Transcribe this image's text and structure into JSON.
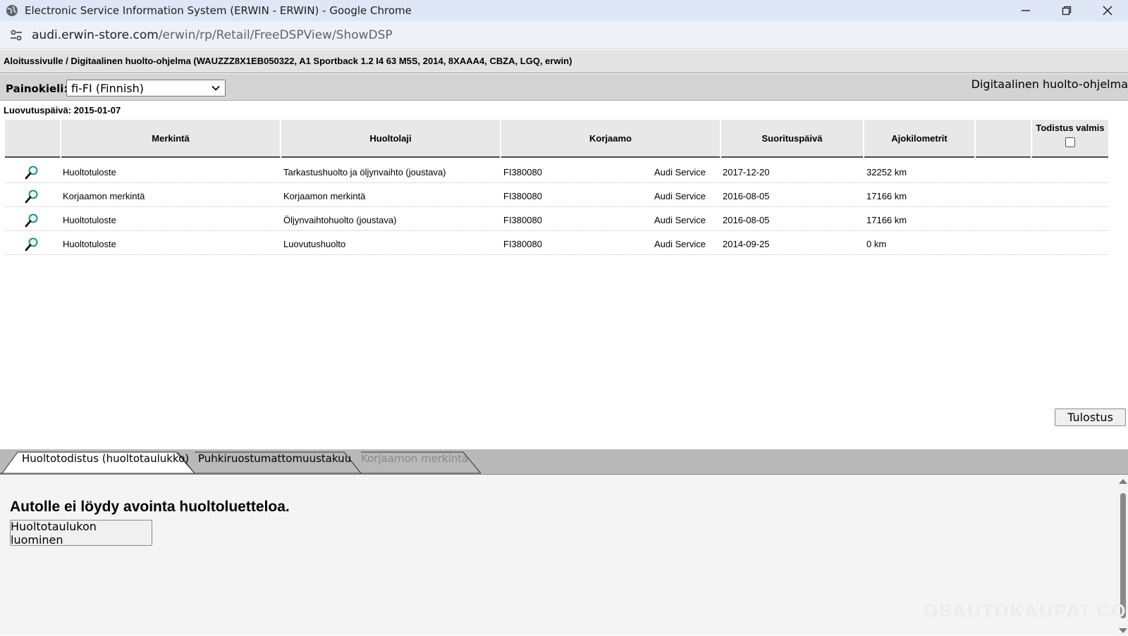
{
  "window": {
    "title": "Electronic Service Information System (ERWIN - ERWIN) - Google Chrome"
  },
  "address": {
    "host": "audi.erwin-store.com",
    "path": "/erwin/rp/Retail/FreeDSPView/ShowDSP"
  },
  "breadcrumb": "Aloitussivulle / Digitaalinen huolto-ohjelma (WAUZZZ8X1EB050322, A1 Sportback 1.2 I4 63 M5S, 2014, 8XAAA4, CBZA, LGQ, erwin)",
  "toolbar": {
    "language_label": "Painokieli:",
    "language_selected": "fi-FI (Finnish)",
    "right_title": "Digitaalinen huolto-ohjelma"
  },
  "delivery_date": "Luovutuspäivä: 2015-01-07",
  "table": {
    "headers": {
      "marking": "Merkintä",
      "service_type": "Huoltolaji",
      "workshop": "Korjaamo",
      "date": "Suorituspäivä",
      "km": "Ajokilometrit",
      "certificate": "Todistus valmis"
    },
    "rows": [
      {
        "marking": "Huoltotuloste",
        "service_type": "Tarkastushuolto ja öljynvaihto (joustava)",
        "workshop_code": "FI380080",
        "workshop_name": "Audi Service",
        "date": "2017-12-20",
        "km": "32252 km"
      },
      {
        "marking": "Korjaamon merkintä",
        "service_type": "Korjaamon merkintä",
        "workshop_code": "FI380080",
        "workshop_name": "Audi Service",
        "date": "2016-08-05",
        "km": "17166 km"
      },
      {
        "marking": "Huoltotuloste",
        "service_type": "Öljynvaihtohuolto (joustava)",
        "workshop_code": "FI380080",
        "workshop_name": "Audi Service",
        "date": "2016-08-05",
        "km": "17166 km"
      },
      {
        "marking": "Huoltotuloste",
        "service_type": "Luovutushuolto",
        "workshop_code": "FI380080",
        "workshop_name": "Audi Service",
        "date": "2014-09-25",
        "km": "0 km"
      }
    ]
  },
  "print_button": "Tulostus",
  "tabs": [
    {
      "label": "Huoltotodistus (huoltotaulukko)",
      "state": "active"
    },
    {
      "label": "Puhkiruostumattomuustakuu",
      "state": "normal"
    },
    {
      "label": "Korjaamon merkintä",
      "state": "disabled"
    }
  ],
  "panel": {
    "message": "Autolle ei löydy avointa huoltoluetteloa.",
    "create_button": "Huoltotaulukon luominen"
  },
  "watermark": "OSAUTOKAUPAT.COM"
}
